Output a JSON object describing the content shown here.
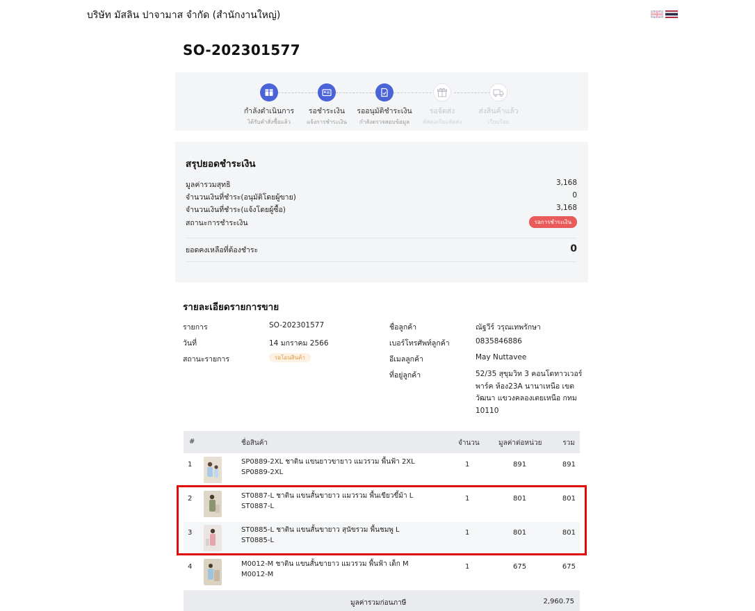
{
  "company": "บริษัท มัสลิน ปาจามาส จำกัด (สำนักงานใหญ่)",
  "order_no": "SO-202301577",
  "steps": [
    {
      "label": "กำลังดำเนินการ",
      "sub": "ได้รับคำสั่งซื้อแล้ว",
      "icon": "box-icon",
      "active": true
    },
    {
      "label": "รอชำระเงิน",
      "sub": "แจ้งการชำระเงิน",
      "icon": "payment-card-icon",
      "active": true
    },
    {
      "label": "รออนุมัติชำระเงิน",
      "sub": "กำลังตรวจสอบข้อมูล",
      "icon": "document-check-icon",
      "active": true
    },
    {
      "label": "รอจัดส่ง",
      "sub": "พัสดุเตรียมจัดส่ง",
      "icon": "gift-box-icon",
      "active": false
    },
    {
      "label": "ส่งสินค้าแล้ว",
      "sub": "เรียบร้อย",
      "icon": "truck-icon",
      "active": false
    }
  ],
  "summary": {
    "title": "สรุปยอดชำระเงิน",
    "rows": [
      {
        "label": "มูลค่ารวมสุทธิ",
        "value": "3,168"
      },
      {
        "label": "จำนวนเงินที่ชำระ(อนุมัติโดยผู้ขาย)",
        "value": "0"
      },
      {
        "label": "จำนวนเงินที่ชำระ(แจ้งโดยผู้ซื้อ)",
        "value": "3,168"
      }
    ],
    "status_label": "สถานะการชำระเงิน",
    "status_badge": "รอการชำระเงิน",
    "balance_label": "ยอดคงเหลือที่ต้องชำระ",
    "balance_value": "0"
  },
  "details": {
    "title": "รายละเอียดรายการขาย",
    "item_label": "รายการ",
    "item_value": "SO-202301577",
    "date_label": "วันที่",
    "date_value": "14 มกราคม 2566",
    "status_label": "สถานะรายการ",
    "status_badge": "รอโอนสินค้า",
    "cust_name_label": "ชื่อลูกค้า",
    "cust_name_value": "ณัฐวีร์ วรุณเทพรักษา",
    "phone_label": "เบอร์โทรศัพท์ลูกค้า",
    "phone_value": "0835846886",
    "email_label": "อีเมลลูกค้า",
    "email_value": "May Nuttavee",
    "address_label": "ที่อยู่ลูกค้า",
    "address_lines": [
      "52/35 สุขุมวิท 3 คอนโดทาวเวอร์",
      "พาร์ค ห้อง23A นานาเหนือ เขต",
      "วัฒนา แขวงคลองเตยเหนือ กทม",
      "10110"
    ]
  },
  "table": {
    "headers": {
      "no": "#",
      "name": "ชื่อสินค้า",
      "qty": "จำนวน",
      "unit": "มูลค่าต่อหน่วย",
      "total": "รวม"
    },
    "rows": [
      {
        "no": "1",
        "name": "SP0889-2XL ชาติน แขนยาวขายาว แมวรวม พื้นฟ้า 2XL",
        "sku": "SP0889-2XL",
        "qty": "1",
        "unit": "891",
        "total": "891"
      },
      {
        "no": "2",
        "name": "ST0887-L ชาติน แขนสั้นขายาว แมวรวม พื้นเขียวขี้ม้า L",
        "sku": "ST0887-L",
        "qty": "1",
        "unit": "801",
        "total": "801"
      },
      {
        "no": "3",
        "name": "ST0885-L ชาติน แขนสั้นขายาว สุนัขรวม พื้นชมพู L",
        "sku": "ST0885-L",
        "qty": "1",
        "unit": "801",
        "total": "801"
      },
      {
        "no": "4",
        "name": "M0012-M ชาติน แขนสั้นขายาว แมวรวม พื้นฟ้า เด็ก M",
        "sku": "M0012-M",
        "qty": "1",
        "unit": "675",
        "total": "675"
      }
    ],
    "footer_label": "มูลค่ารวมก่อนภาษี",
    "footer_value": "2,960.75"
  },
  "colors": {
    "accent": "#4a63d6",
    "danger": "#e95b5b",
    "highlight": "#e10a0a"
  }
}
